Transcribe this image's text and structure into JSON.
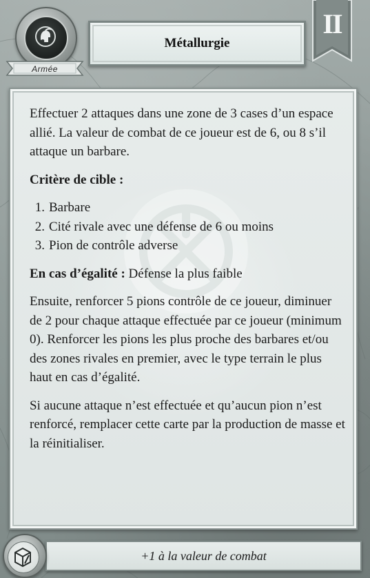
{
  "card": {
    "category": "Armée",
    "title": "Métallurgie",
    "age": "II",
    "bonus": "+1 à la valeur de combat"
  },
  "body": {
    "intro": "Effectuer 2 attaques dans une zone de 3 cases d’un espace allié. La valeur de combat de ce joueur est de 6, ou 8 s’il attaque un barbare.",
    "target_heading": "Critère de cible :",
    "targets": [
      {
        "num": "1.",
        "text": "Barbare"
      },
      {
        "num": "2.",
        "text": "Cité rivale avec une défense de 6 ou moins"
      },
      {
        "num": "3.",
        "text": "Pion de contrôle adverse"
      }
    ],
    "tie_label": "En cas d’égalité :",
    "tie_text": " Défense la plus faible",
    "then": "Ensuite, renforcer 5 pions contrôle de ce joueur, diminuer de 2 pour chaque attaque effectuée par ce joueur (minimum 0). Renforcer les pions les plus proche des barbares et/ou des zones rivales en premier, avec le type terrain le plus haut en cas d’égalité.",
    "fallback": "Si aucune attaque n’est effectuée et qu’aucun pion n’est renforcé, remplacer cette carte par la production de masse et la réinitialiser."
  },
  "icons": {
    "category_emblem": "helmet-icon",
    "watermark": "wheel-icon",
    "bonus_emblem": "cube-icon"
  },
  "colors": {
    "panel": "#e4e9e8",
    "frame": "#8d9896",
    "emblem_dark": "#1b1f1e",
    "age_text": "#f4f6f5"
  }
}
